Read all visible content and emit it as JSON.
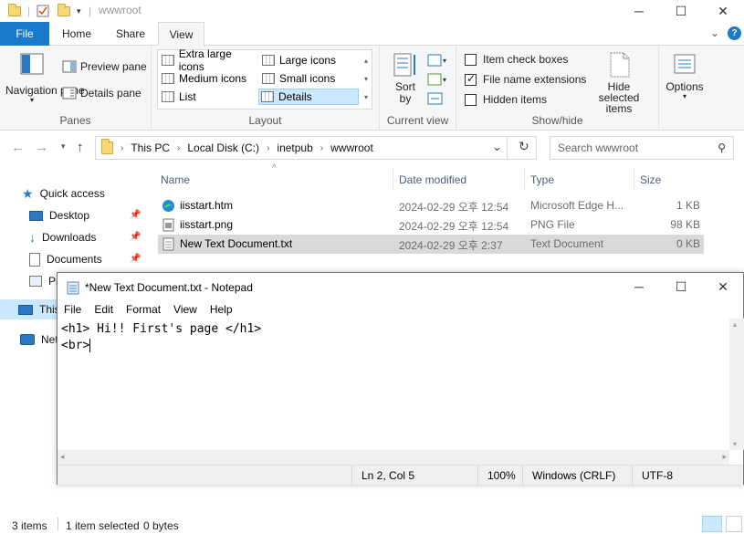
{
  "explorer": {
    "window_title": "wwwroot",
    "ribbon_tabs": [
      "File",
      "Home",
      "Share",
      "View"
    ],
    "panes_group": {
      "label": "Panes",
      "navigation_pane": "Navigation pane",
      "preview_pane": "Preview pane",
      "details_pane": "Details pane"
    },
    "layout_group": {
      "label": "Layout",
      "items": [
        "Extra large icons",
        "Large icons",
        "Medium icons",
        "Small icons",
        "List",
        "Details"
      ],
      "selected": "Details"
    },
    "current_view_group": {
      "label": "Current view",
      "sort_by": "Sort by"
    },
    "show_hide_group": {
      "label": "Show/hide",
      "item_check_boxes": "Item check boxes",
      "file_name_extensions": "File name extensions",
      "hidden_items": "Hidden items",
      "hide_selected_items": "Hide selected items"
    },
    "options": "Options",
    "breadcrumb": [
      "This PC",
      "Local Disk (C:)",
      "inetpub",
      "wwwroot"
    ],
    "search_placeholder": "Search wwwroot",
    "nav_items": {
      "quick_access": "Quick access",
      "desktop": "Desktop",
      "downloads": "Downloads",
      "documents": "Documents",
      "pictures": "Pi",
      "this_pc": "This",
      "network": "Net"
    },
    "columns": [
      "Name",
      "Date modified",
      "Type",
      "Size"
    ],
    "files": [
      {
        "name": "iisstart.htm",
        "date": "2024-02-29 오후 12:54",
        "type": "Microsoft Edge H...",
        "size": "1 KB"
      },
      {
        "name": "iisstart.png",
        "date": "2024-02-29 오후 12:54",
        "type": "PNG File",
        "size": "98 KB"
      },
      {
        "name": "New Text Document.txt",
        "date": "2024-02-29 오후 2:37",
        "type": "Text Document",
        "size": "0 KB"
      }
    ],
    "status": {
      "items": "3 items",
      "selected": "1 item selected",
      "bytes": "0 bytes"
    }
  },
  "notepad": {
    "title": "*New Text Document.txt - Notepad",
    "menu": [
      "File",
      "Edit",
      "Format",
      "View",
      "Help"
    ],
    "lines": [
      "<h1> Hi!! First's page </h1>",
      "<br>"
    ],
    "status": {
      "position": "Ln 2, Col 5",
      "zoom": "100%",
      "line_ending": "Windows (CRLF)",
      "encoding": "UTF-8"
    }
  }
}
